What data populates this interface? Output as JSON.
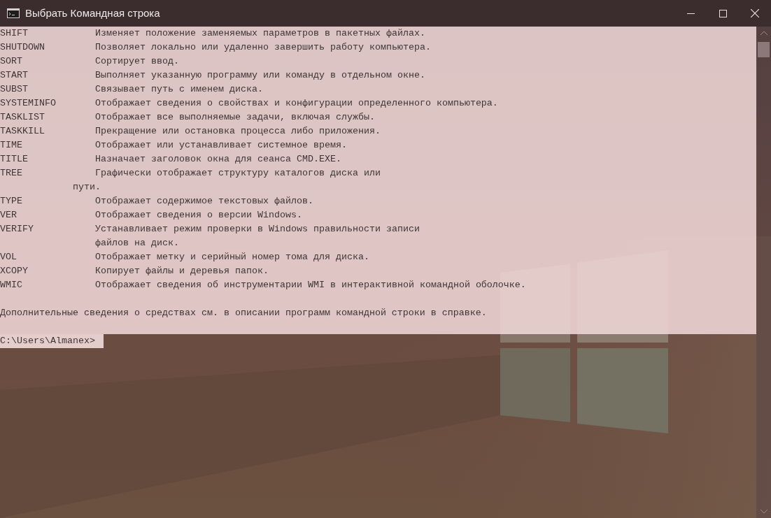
{
  "window": {
    "title": "Выбрать Командная строка"
  },
  "lines": [
    {
      "kind": "command",
      "name": "SHIFT",
      "description": "Изменяет положение заменяемых параметров в пакетных файлах.",
      "selected": true
    },
    {
      "kind": "command",
      "name": "SHUTDOWN",
      "description": "Позволяет локально или удаленно завершить работу компьютера.",
      "selected": true
    },
    {
      "kind": "command",
      "name": "SORT",
      "description": "Сортирует ввод.",
      "selected": true
    },
    {
      "kind": "command",
      "name": "START",
      "description": "Выполняет указанную программу или команду в отдельном окне.",
      "selected": true
    },
    {
      "kind": "command",
      "name": "SUBST",
      "description": "Связывает путь с именем диска.",
      "selected": true
    },
    {
      "kind": "command",
      "name": "SYSTEMINFO",
      "description": "Отображает сведения о свойствах и конфигурации определенного компьютера.",
      "selected": true
    },
    {
      "kind": "command",
      "name": "TASKLIST",
      "description": "Отображает все выполняемые задачи, включая службы.",
      "selected": true
    },
    {
      "kind": "command",
      "name": "TASKKILL",
      "description": "Прекращение или остановка процесса либо приложения.",
      "selected": true
    },
    {
      "kind": "command",
      "name": "TIME",
      "description": "Отображает или устанавливает системное время.",
      "selected": true
    },
    {
      "kind": "command",
      "name": "TITLE",
      "description": "Назначает заголовок окна для сеанса CMD.EXE.",
      "selected": true
    },
    {
      "kind": "command",
      "name": "TREE",
      "description": "Графически отображает структуру каталогов диска или",
      "selected": true
    },
    {
      "kind": "wrapped",
      "text": "пути.",
      "selected": true
    },
    {
      "kind": "command",
      "name": "TYPE",
      "description": "Отображает содержимое текстовых файлов.",
      "selected": true
    },
    {
      "kind": "command",
      "name": "VER",
      "description": "Отображает сведения о версии Windows.",
      "selected": true
    },
    {
      "kind": "command",
      "name": "VERIFY",
      "description": "Устанавливает режим проверки в Windows правильности записи",
      "selected": true
    },
    {
      "kind": "continued",
      "text": "файлов на диск.",
      "selected": true
    },
    {
      "kind": "command",
      "name": "VOL",
      "description": "Отображает метку и серийный номер тома для диска.",
      "selected": true
    },
    {
      "kind": "command",
      "name": "XCOPY",
      "description": "Копирует файлы и деревья папок.",
      "selected": true
    },
    {
      "kind": "command",
      "name": "WMIC",
      "description": "Отображает сведения об инструментарии WMI в интерактивной командной оболочке.",
      "selected": true
    },
    {
      "kind": "blank",
      "selected": true
    },
    {
      "kind": "text",
      "text": "Дополнительные сведения о средствах см. в описании программ командной строки в справке.",
      "selected": true
    },
    {
      "kind": "blank",
      "selected": true
    }
  ],
  "prompt": {
    "text": "C:\\Users\\Almanex>",
    "selected": true
  }
}
